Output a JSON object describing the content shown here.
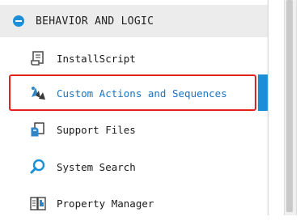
{
  "section": {
    "title": "BEHAVIOR AND LOGIC"
  },
  "items": [
    {
      "label": "InstallScript",
      "icon": "script-icon"
    },
    {
      "label": "Custom Actions and Sequences",
      "icon": "custom-actions-icon",
      "selected": true
    },
    {
      "label": "Support Files",
      "icon": "support-files-icon"
    },
    {
      "label": "System Search",
      "icon": "search-icon"
    },
    {
      "label": "Property Manager",
      "icon": "property-manager-icon"
    }
  ],
  "colors": {
    "accent": "#1d8fd6",
    "highlight_border": "#e2231a",
    "selected_text": "#1a73c2"
  }
}
